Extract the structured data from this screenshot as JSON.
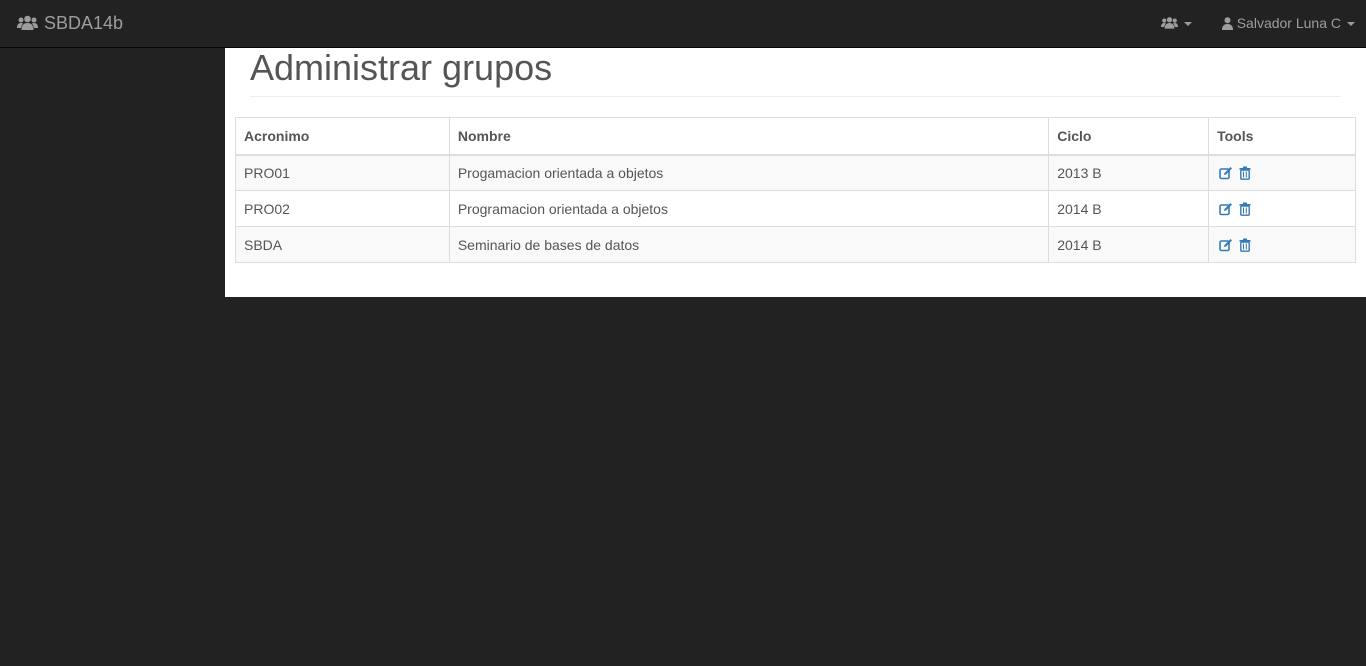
{
  "navbar": {
    "brand_icon": "users-icon",
    "brand_label": "SBDA14b",
    "groups_menu_icon": "users-icon",
    "user_icon": "user-icon",
    "user_label": "Salvador Luna C"
  },
  "main": {
    "title": "Administrar grupos",
    "table": {
      "headers": [
        "Acronimo",
        "Nombre",
        "Ciclo",
        "Tools"
      ],
      "rows": [
        {
          "acronimo": "PRO01",
          "nombre": "Progamacion orientada a objetos",
          "ciclo": "2013 B"
        },
        {
          "acronimo": "PRO02",
          "nombre": "Programacion orientada a objetos",
          "ciclo": "2014 B"
        },
        {
          "acronimo": "SBDA",
          "nombre": "Seminario de bases de datos",
          "ciclo": "2014 B"
        }
      ],
      "tool_icons": [
        "edit-icon",
        "trash-icon"
      ]
    }
  },
  "colors": {
    "navbar_bg": "#222222",
    "nav_text": "#9d9d9d",
    "link": "#337ab7",
    "text": "#555555"
  }
}
